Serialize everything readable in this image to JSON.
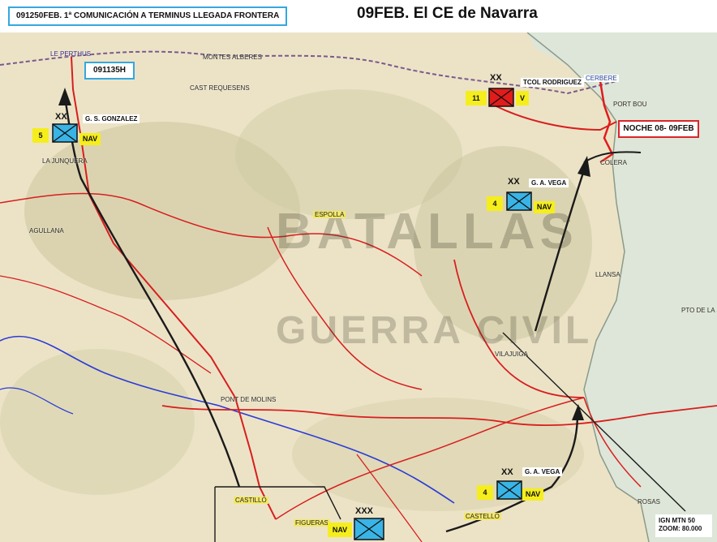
{
  "header": {
    "title": "09FEB. El CE de Navarra",
    "subtitle": "091250FEB. 1ª COMUNICACIÓN A TERMINUS LLEGADA FRONTERA"
  },
  "map": {
    "place_labels": [
      "LE PERTHUS",
      "MONTES ALBERES",
      "CAST REQUESENS",
      "CERBERE",
      "PORT BOU",
      "COLERA",
      "LA JUNQUERA",
      "ESPOLLA",
      "LLANSA",
      "PTO DE LA SELVA",
      "AGULLANA",
      "VILAJUIGA",
      "PONT DE MOLINS",
      "CASTILLO",
      "FIGUERAS",
      "CASTELLO",
      "ROSAS"
    ],
    "callouts": {
      "time_box": "091135H",
      "night_box": "NOCHE 08- 09FEB"
    },
    "units": [
      {
        "commander": "G. S. GONZALEZ",
        "number": "5",
        "tag": "NAV",
        "echelon": "XX",
        "color": "#39b4e6"
      },
      {
        "commander": "TCOL RODRIGUEZ",
        "number": "11",
        "tag": "V",
        "echelon": "XX",
        "color": "#e21b1b"
      },
      {
        "commander": "G. A. VEGA",
        "number": "4",
        "tag": "NAV",
        "echelon": "XX",
        "color": "#39b4e6"
      },
      {
        "commander": "G. A. VEGA",
        "number": "4",
        "tag": "NAV",
        "echelon": "XX",
        "color": "#39b4e6"
      },
      {
        "commander": "",
        "number": "",
        "tag": "NAV",
        "echelon": "XXX",
        "color": "#39b4e6"
      }
    ],
    "scale": {
      "source": "IGN MTN 50",
      "zoom": "ZOOM: 80.000"
    },
    "watermark": {
      "line1": "BATALLAS",
      "line2": "GUERRA CIVIL"
    }
  }
}
